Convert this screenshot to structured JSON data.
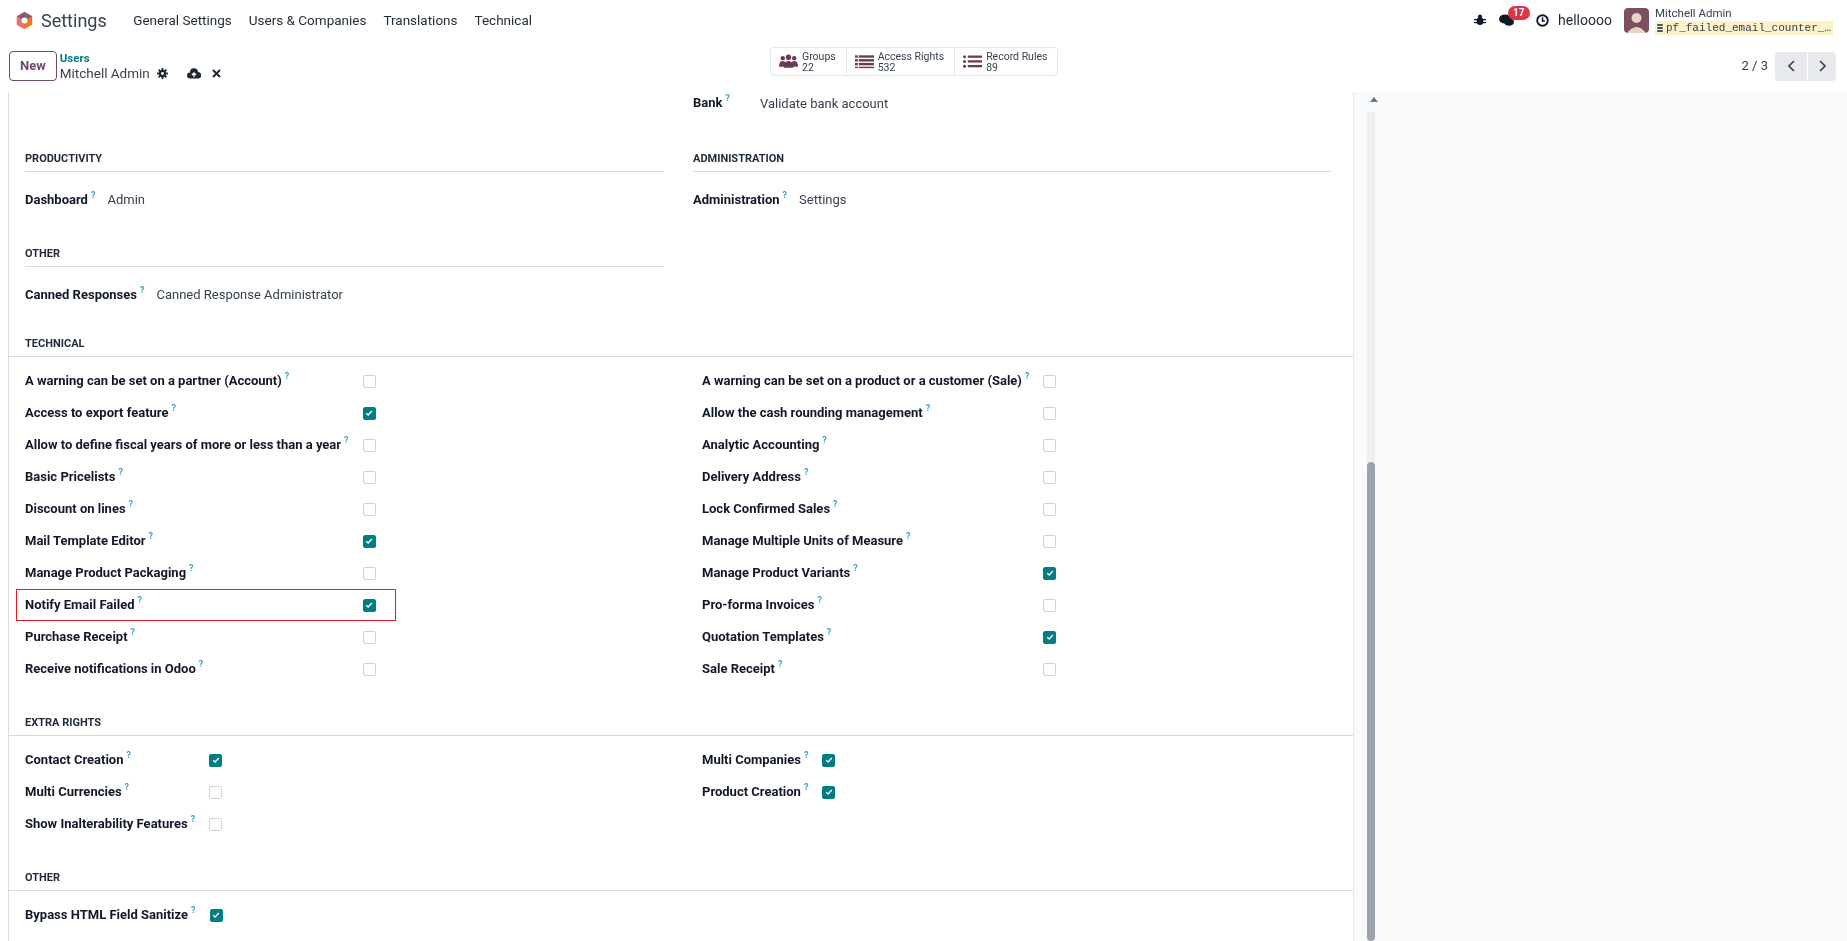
{
  "navbar": {
    "app": "Settings",
    "menu": [
      "General Settings",
      "Users & Companies",
      "Translations",
      "Technical"
    ],
    "messages_badge": "17",
    "database_label": "helloooo",
    "user": {
      "name": "Mitchell Admin",
      "database": "pf_failed_email_counter_…"
    }
  },
  "control_panel": {
    "new_button": "New",
    "breadcrumb": "Users",
    "record": "Mitchell Admin",
    "smart_buttons": [
      {
        "kind": "groups",
        "label": "Groups",
        "count": "22"
      },
      {
        "kind": "list",
        "label": "Access Rights",
        "count": "532"
      },
      {
        "kind": "bullets",
        "label": "Record Rules",
        "count": "89"
      }
    ],
    "pager": "2 / 3"
  },
  "form": {
    "top_field": {
      "label": "Bank",
      "help": "?",
      "value": "Validate bank account"
    },
    "left_column": [
      {
        "title": "PRODUCTIVITY",
        "fields": [
          {
            "label": "Dashboard",
            "help": "?",
            "value": "Admin"
          }
        ]
      },
      {
        "title": "OTHER",
        "fields": [
          {
            "label": "Canned Responses",
            "help": "?",
            "value": "Canned Response Administrator"
          }
        ]
      }
    ],
    "right_column": [
      {
        "title": "ADMINISTRATION",
        "fields": [
          {
            "label": "Administration",
            "help": "?",
            "value": "Settings"
          }
        ]
      }
    ],
    "checkbox_sections": [
      {
        "title": "TECHNICAL",
        "left": [
          {
            "label": "A warning can be set on a partner (Account)",
            "help": "?",
            "checked": false,
            "highlighted": false
          },
          {
            "label": "Access to export feature",
            "help": "?",
            "checked": true,
            "highlighted": false
          },
          {
            "label": "Allow to define fiscal years of more or less than a year",
            "help": "?",
            "checked": false,
            "highlighted": false
          },
          {
            "label": "Basic Pricelists",
            "help": "?",
            "checked": false,
            "highlighted": false
          },
          {
            "label": "Discount on lines",
            "help": "?",
            "checked": false,
            "highlighted": false
          },
          {
            "label": "Mail Template Editor",
            "help": "?",
            "checked": true,
            "highlighted": false
          },
          {
            "label": "Manage Product Packaging",
            "help": "?",
            "checked": false,
            "highlighted": false
          },
          {
            "label": "Notify Email Failed",
            "help": "?",
            "checked": true,
            "highlighted": true
          },
          {
            "label": "Purchase Receipt",
            "help": "?",
            "checked": false,
            "highlighted": false
          },
          {
            "label": "Receive notifications in Odoo",
            "help": "?",
            "checked": false,
            "highlighted": false
          }
        ],
        "right": [
          {
            "label": "A warning can be set on a product or a customer (Sale)",
            "help": "?",
            "checked": false,
            "highlighted": false
          },
          {
            "label": "Allow the cash rounding management",
            "help": "?",
            "checked": false,
            "highlighted": false
          },
          {
            "label": "Analytic Accounting",
            "help": "?",
            "checked": false,
            "highlighted": false
          },
          {
            "label": "Delivery Address",
            "help": "?",
            "checked": false,
            "highlighted": false
          },
          {
            "label": "Lock Confirmed Sales",
            "help": "?",
            "checked": false,
            "highlighted": false
          },
          {
            "label": "Manage Multiple Units of Measure",
            "help": "?",
            "checked": false,
            "highlighted": false
          },
          {
            "label": "Manage Product Variants",
            "help": "?",
            "checked": true,
            "highlighted": false
          },
          {
            "label": "Pro-forma Invoices",
            "help": "?",
            "checked": false,
            "highlighted": false
          },
          {
            "label": "Quotation Templates",
            "help": "?",
            "checked": true,
            "highlighted": false
          },
          {
            "label": "Sale Receipt",
            "help": "?",
            "checked": false,
            "highlighted": false
          }
        ]
      },
      {
        "title": "EXTRA RIGHTS",
        "left": [
          {
            "label": "Contact Creation",
            "help": "?",
            "checked": true,
            "highlighted": false
          },
          {
            "label": "Multi Currencies",
            "help": "?",
            "checked": false,
            "highlighted": false
          },
          {
            "label": "Show Inalterability Features",
            "help": "?",
            "checked": false,
            "highlighted": false
          }
        ],
        "right": [
          {
            "label": "Multi Companies",
            "help": "?",
            "checked": true,
            "highlighted": false
          },
          {
            "label": "Product Creation",
            "help": "?",
            "checked": true,
            "highlighted": false
          }
        ]
      },
      {
        "title": "OTHER",
        "left": [
          {
            "label": "Bypass HTML Field Sanitize",
            "help": "?",
            "checked": true,
            "highlighted": false
          }
        ]
      }
    ]
  }
}
